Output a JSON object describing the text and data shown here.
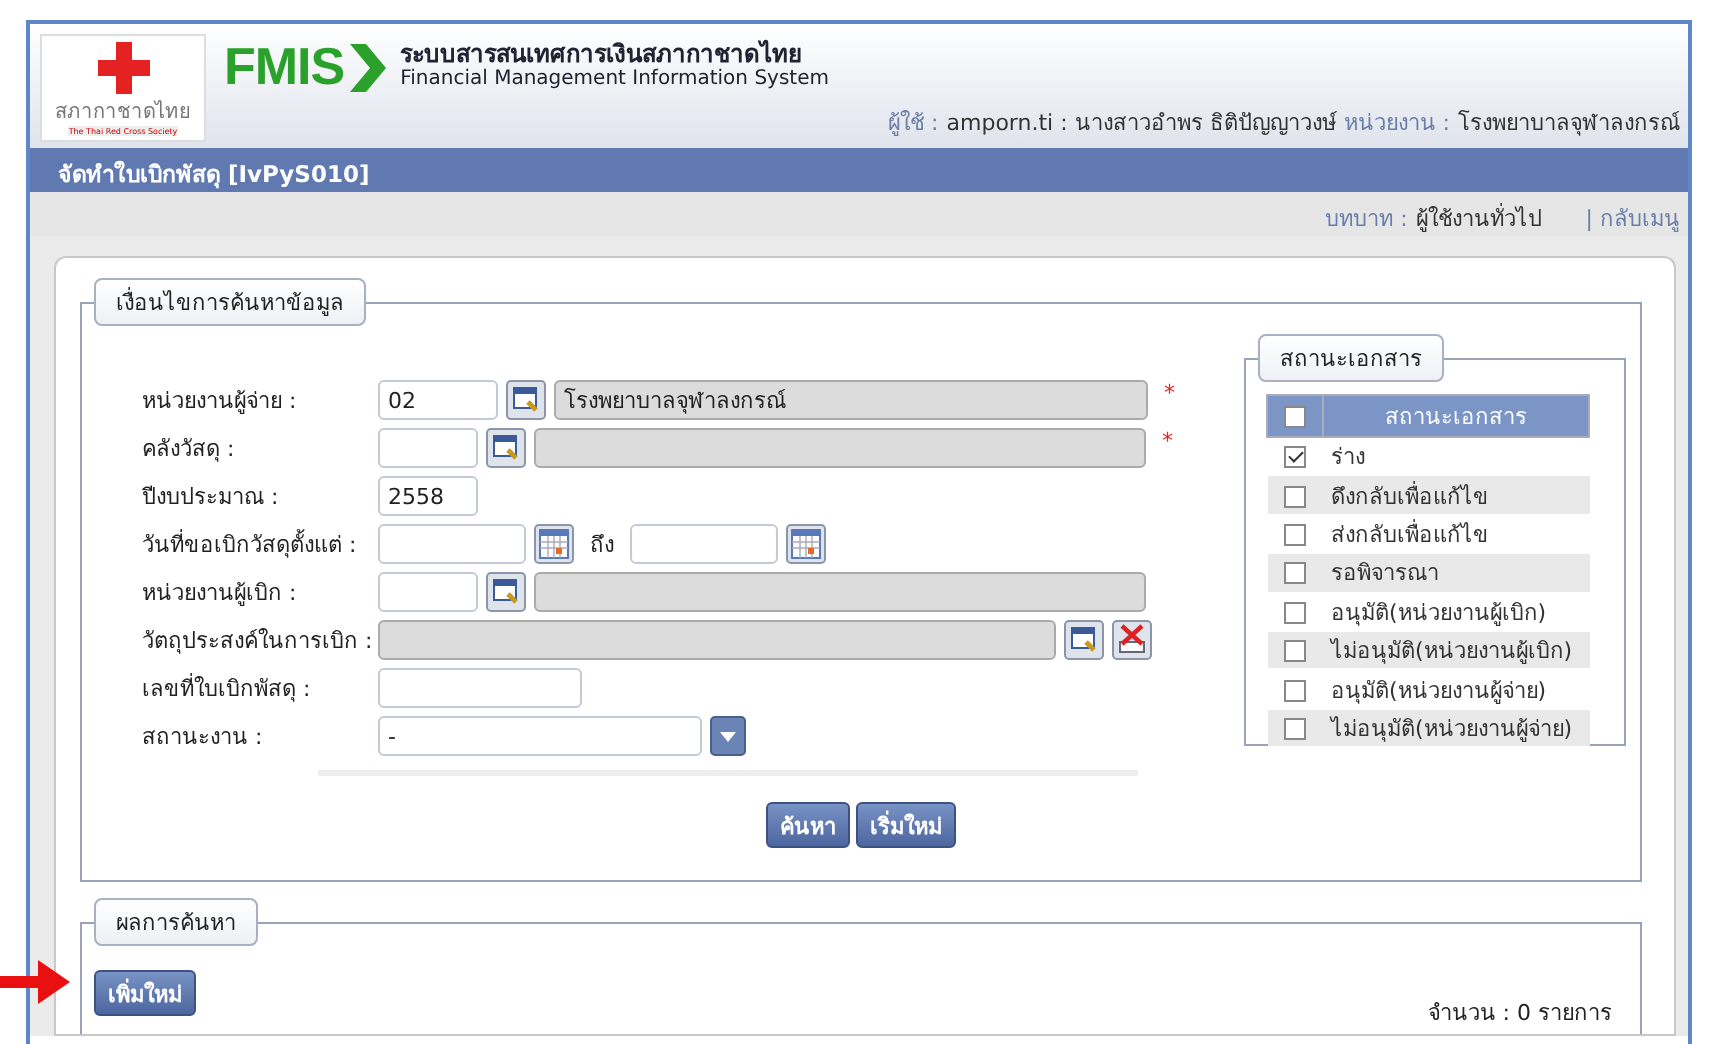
{
  "header": {
    "logo_text": "สภากาชาดไทย",
    "logo_subtext": "The Thai Red Cross Society",
    "brand": "FMIS",
    "system_name": "ระบบสารสนเทศการเงินสภากาชาดไทย",
    "system_name_en": "Financial Management Information System",
    "user_label": "ผู้ใช้ :",
    "user_value": "amporn.ti : นางสาวอำพร ธิติปัญญาวงษ์",
    "unit_label": "หน่วยงาน :",
    "unit_value": "โรงพยาบาลจุฬาลงกรณ์"
  },
  "page_title": "จัดทำใบเบิกพัสดุ [IvPyS010]",
  "role_bar": {
    "label": "บทบาท :",
    "value": "ผู้ใช้งานทั่วไป",
    "back_link": "| กลับเมนู"
  },
  "search": {
    "legend": "เงื่อนไขการค้นหาข้อมูล",
    "fields": [
      {
        "kind": "lookup",
        "label": "หน่วยงานผู้จ่าย :",
        "value": "02",
        "name": "โรงพยาบาลจุฬาลงกรณ์",
        "marker": "*"
      },
      {
        "kind": "lookup",
        "label": "คลังวัสดุ :",
        "marker": "*"
      },
      {
        "kind": "number",
        "label": "ปีงบประมาณ :",
        "value": "2558"
      },
      {
        "kind": "daterange",
        "label": "วันที่ขอเบิกวัสดุตั้งแต่ :",
        "to_label": "ถึง"
      },
      {
        "kind": "lookup",
        "label": "หน่วยงานผู้เบิก :"
      },
      {
        "kind": "wide_lookup",
        "label": "วัตถุประสงค์ในการเบิก :"
      },
      {
        "kind": "text",
        "label": "เลขที่ใบเบิกพัสดุ :"
      },
      {
        "kind": "select",
        "label": "สถานะงาน :",
        "value": "-"
      }
    ],
    "buttons": [
      "ค้นหา",
      "เริ่มใหม่"
    ],
    "status_panel": {
      "legend": "สถานะเอกสาร",
      "header_checked": false,
      "column": "สถานะเอกสาร",
      "rows": [
        {
          "label": "ร่าง",
          "checked": true
        },
        {
          "label": "ดึงกลับเพื่อแก้ไข",
          "checked": false
        },
        {
          "label": "ส่งกลับเพื่อแก้ไข",
          "checked": false
        },
        {
          "label": "รอพิจารณา",
          "checked": false
        },
        {
          "label": "อนุมัติ(หน่วยงานผู้เบิก)",
          "checked": false
        },
        {
          "label": "ไม่อนุมัติ(หน่วยงานผู้เบิก)",
          "checked": false
        },
        {
          "label": "อนุมัติ(หน่วยงานผู้จ่าย)",
          "checked": false
        },
        {
          "label": "ไม่อนุมัติ(หน่วยงานผู้จ่าย)",
          "checked": false
        }
      ]
    }
  },
  "results": {
    "legend": "ผลการค้นหา",
    "add_button": "เพิ่มใหม่",
    "count": "จำนวน : 0 รายการ"
  }
}
